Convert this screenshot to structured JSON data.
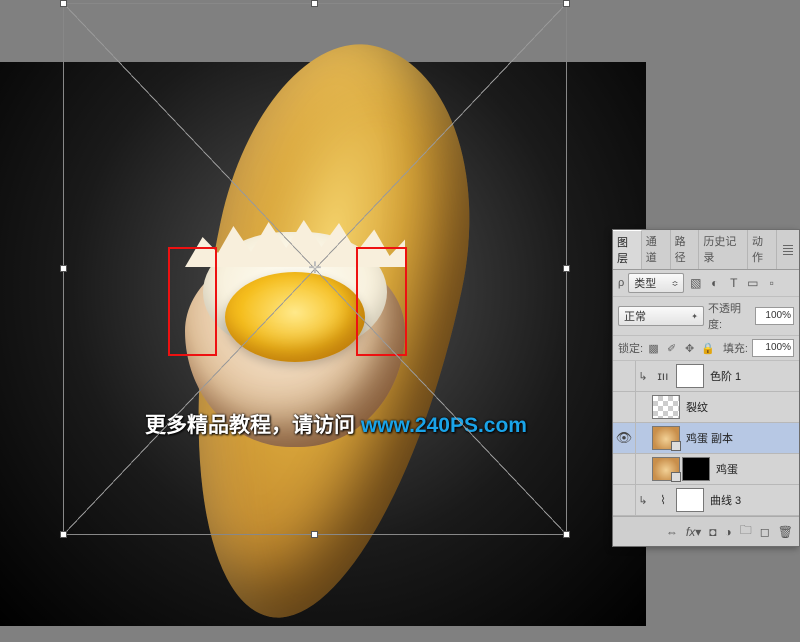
{
  "watermark": {
    "text_cn": "更多精品教程，请访问 ",
    "url": "www.240PS.com"
  },
  "red_highlights": 2,
  "panel": {
    "tabs": [
      "图层",
      "通道",
      "路径",
      "历史记录",
      "动作"
    ],
    "active_tab_index": 0,
    "kind_label": "类型",
    "filter_icons": [
      "image",
      "adjust",
      "type",
      "shape",
      "smart"
    ],
    "blend_mode": "正常",
    "opacity_label": "不透明度:",
    "opacity_value": "100%",
    "lock_label": "锁定:",
    "fill_label": "填充:",
    "fill_value": "100%",
    "layers": [
      {
        "visible": false,
        "clip": true,
        "type": "adjustment",
        "adj_icon": "levels",
        "mask": "white",
        "name": "色阶 1"
      },
      {
        "visible": false,
        "clip": false,
        "type": "bitmap",
        "thumb": "checker",
        "name": "裂纹"
      },
      {
        "visible": true,
        "clip": false,
        "type": "smart",
        "thumb": "egg",
        "name": "鸡蛋 副本",
        "selected": true
      },
      {
        "visible": false,
        "clip": false,
        "type": "smart",
        "thumb": "egg",
        "mask": "black",
        "name": "鸡蛋"
      },
      {
        "visible": false,
        "clip": true,
        "type": "adjustment",
        "adj_icon": "curves",
        "mask": "white",
        "name": "曲线 3"
      }
    ],
    "footer_icons": [
      "link",
      "fx",
      "mask",
      "adjust",
      "group",
      "new",
      "trash"
    ]
  }
}
